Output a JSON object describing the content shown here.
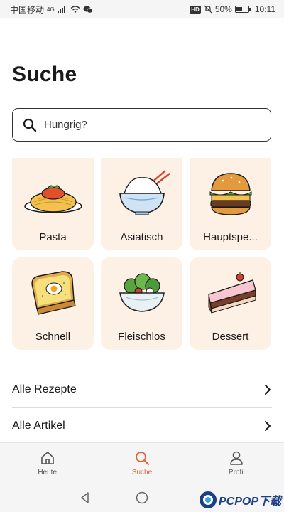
{
  "status_bar": {
    "carrier": "中国移动",
    "network": "4G",
    "battery": "50%",
    "battery_level": 0.5,
    "time": "10:11"
  },
  "page": {
    "title": "Suche"
  },
  "search": {
    "placeholder": "Hungrig?"
  },
  "categories": [
    {
      "label": "Pasta",
      "icon": "pasta-icon"
    },
    {
      "label": "Asiatisch",
      "icon": "rice-bowl-icon"
    },
    {
      "label": "Hauptspe...",
      "icon": "burger-icon"
    },
    {
      "label": "Schnell",
      "icon": "toast-icon"
    },
    {
      "label": "Fleischlos",
      "icon": "salad-icon"
    },
    {
      "label": "Dessert",
      "icon": "cake-icon"
    }
  ],
  "links": [
    {
      "label": "Alle Rezepte"
    },
    {
      "label": "Alle Artikel"
    }
  ],
  "bottom_nav": [
    {
      "label": "Heute",
      "icon": "home-icon",
      "active": false
    },
    {
      "label": "Suche",
      "icon": "search-icon",
      "active": true
    },
    {
      "label": "Profil",
      "icon": "profile-icon",
      "active": false
    }
  ],
  "colors": {
    "accent": "#e06436",
    "tile_background": "#fdf1e5",
    "text": "#1a1a1a"
  },
  "watermark": {
    "text": "PCPOP下载"
  }
}
